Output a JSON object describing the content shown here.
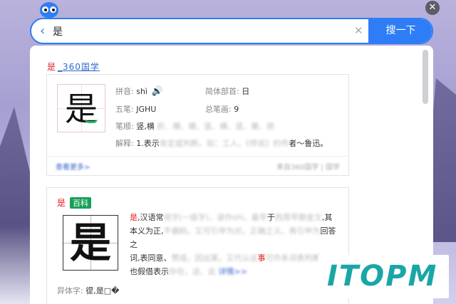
{
  "search": {
    "query": "是",
    "button_label": "搜一下"
  },
  "result": {
    "title_char": "是",
    "title_source": "_360国学",
    "pinyin_label": "拼音:",
    "pinyin": "shì",
    "radical_label": "简体部首:",
    "radical": "日",
    "wubi_label": "五笔:",
    "wubi": "JGHU",
    "strokes_label": "总笔画:",
    "strokes": "9",
    "order_label": "笔顺:",
    "order_visible": "竖,横",
    "order_blurred": "折、横、横、竖、横、竖、撇、捺",
    "explain_label": "解释:",
    "explain_prefix": "1.表示",
    "explain_blurred": "肯定或判断。如：工人。《师说》",
    "explain_blurred2": "的传",
    "explain_suffix": "者～鲁迅。",
    "more_link": "查看更多>",
    "source_note": "来自360国学 | 国学"
  },
  "baike": {
    "char": "是",
    "badge": "百科",
    "line1_hl": "是",
    "line1_a": ",汉语常",
    "line1_blur": "用字(一级字)，读作shì。最早",
    "line1_b": "于",
    "line1_blur2": "西周早期金文",
    "line1_c": ",其",
    "line2_a": "本义为正,",
    "line2_blur": "不偏斜。又可引申为对，正确之义。再引申为",
    "line2_b": "回答之",
    "line3_a": "词,表同意、",
    "line3_blur": "赞成，因出某。又代认这",
    "line3_hl": "事",
    "line3_blur2": "可作系词表判断，",
    "line3_b": "。",
    "line4_a": "也假借表示",
    "line4_blur": "存在，这、此",
    "line4_link": "详情>>",
    "variant_label": "异体字:",
    "variants": "徥,是□�"
  },
  "watermark": "ITOPM",
  "colors": {
    "accent": "#2f7df6",
    "highlight": "#e02020",
    "badge": "#18a058",
    "watermark": "#1aa6a6"
  },
  "icons": {
    "back": "chevron-left-icon",
    "clear": "close-icon",
    "speaker": "speaker-icon",
    "close": "close-circle-icon",
    "mascot": "owl-mascot-icon"
  }
}
